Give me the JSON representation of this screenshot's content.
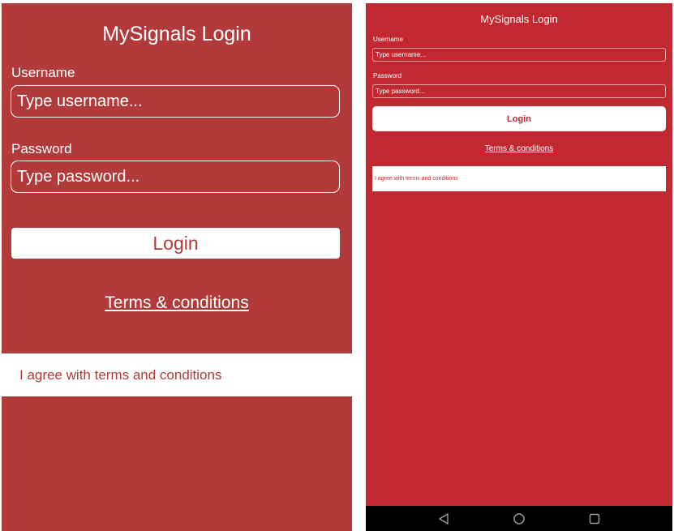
{
  "ios": {
    "title": "MySignals Login",
    "username_label": "Username",
    "username_placeholder": "Type username...",
    "password_label": "Password",
    "password_placeholder": "Type password...",
    "login_label": "Login",
    "terms_label": "Terms & conditions",
    "agree_label": "I agree with terms and conditions"
  },
  "android": {
    "title": "MySignals Login",
    "username_label": "Username",
    "username_placeholder": "Type username...",
    "password_label": "Password",
    "password_placeholder": "Type password...",
    "login_label": "Login",
    "terms_label": "Terms & conditions",
    "agree_label": "I agree with terms and conditions",
    "navbar": {
      "icons": [
        "back-icon",
        "home-icon",
        "recents-icon"
      ]
    }
  },
  "colors": {
    "ios_background": "#b33a3b",
    "android_background": "#c1282f",
    "navbar": "#000000"
  }
}
